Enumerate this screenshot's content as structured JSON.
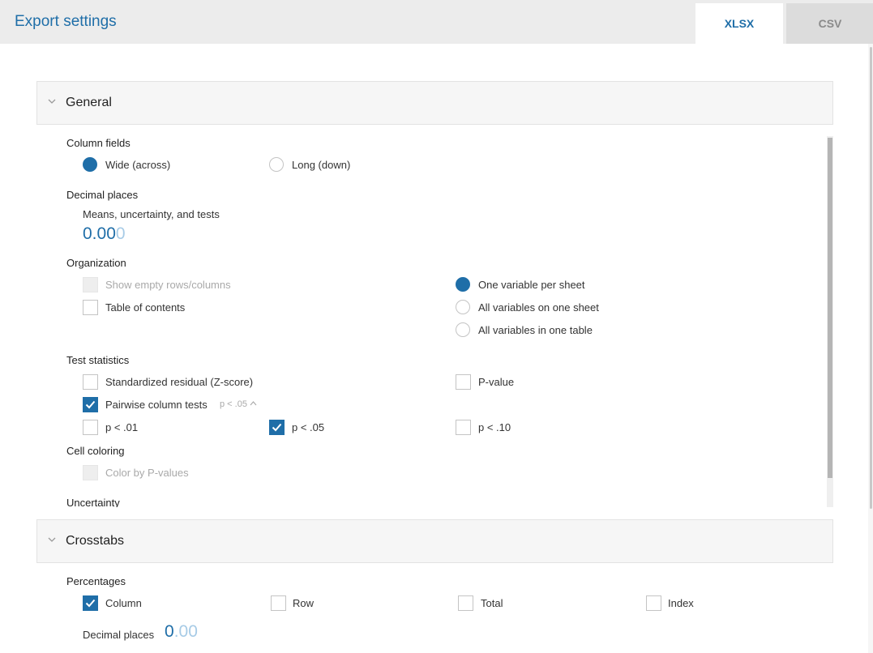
{
  "header": {
    "title": "Export settings",
    "tabs": [
      {
        "label": "XLSX",
        "active": true
      },
      {
        "label": "CSV",
        "active": false
      }
    ]
  },
  "colors": {
    "accent": "#1f6ea8",
    "disabled": "#a9a9a9",
    "header_bg": "#ececec"
  },
  "general": {
    "title": "General",
    "expanded": true,
    "column_fields": {
      "label": "Column fields",
      "options": [
        {
          "label": "Wide (across)",
          "selected": true
        },
        {
          "label": "Long (down)",
          "selected": false
        }
      ]
    },
    "decimal_places": {
      "label": "Decimal places",
      "sublabel": "Means, uncertainty, and tests",
      "value_main": "0.00",
      "value_faint": "0"
    },
    "organization": {
      "label": "Organization",
      "checkboxes": [
        {
          "label": "Show empty rows/columns",
          "checked": false,
          "disabled": true
        },
        {
          "label": "Table of contents",
          "checked": false,
          "disabled": false
        }
      ],
      "radios": [
        {
          "label": "One variable per sheet",
          "selected": true
        },
        {
          "label": "All variables on one sheet",
          "selected": false
        },
        {
          "label": "All variables in one table",
          "selected": false
        }
      ]
    },
    "test_statistics": {
      "label": "Test statistics",
      "standardized_residual": {
        "label": "Standardized residual (Z-score)",
        "checked": false
      },
      "p_value": {
        "label": "P-value",
        "checked": false
      },
      "pairwise": {
        "label": "Pairwise column tests",
        "checked": true,
        "hint": "p < .05"
      },
      "thresholds": [
        {
          "label": "p < .01",
          "checked": false
        },
        {
          "label": "p < .05",
          "checked": true
        },
        {
          "label": "p < .10",
          "checked": false
        }
      ]
    },
    "cell_coloring": {
      "label": "Cell coloring",
      "option": {
        "label": "Color by P-values",
        "checked": false,
        "disabled": true
      }
    },
    "uncertainty": {
      "label": "Uncertainty"
    }
  },
  "crosstabs": {
    "title": "Crosstabs",
    "expanded": true,
    "percentages": {
      "label": "Percentages",
      "options": [
        {
          "label": "Column",
          "checked": true
        },
        {
          "label": "Row",
          "checked": false
        },
        {
          "label": "Total",
          "checked": false
        },
        {
          "label": "Index",
          "checked": false
        }
      ]
    },
    "decimal_places": {
      "label": "Decimal places",
      "value_main": "0",
      "value_faint": ".00"
    }
  }
}
